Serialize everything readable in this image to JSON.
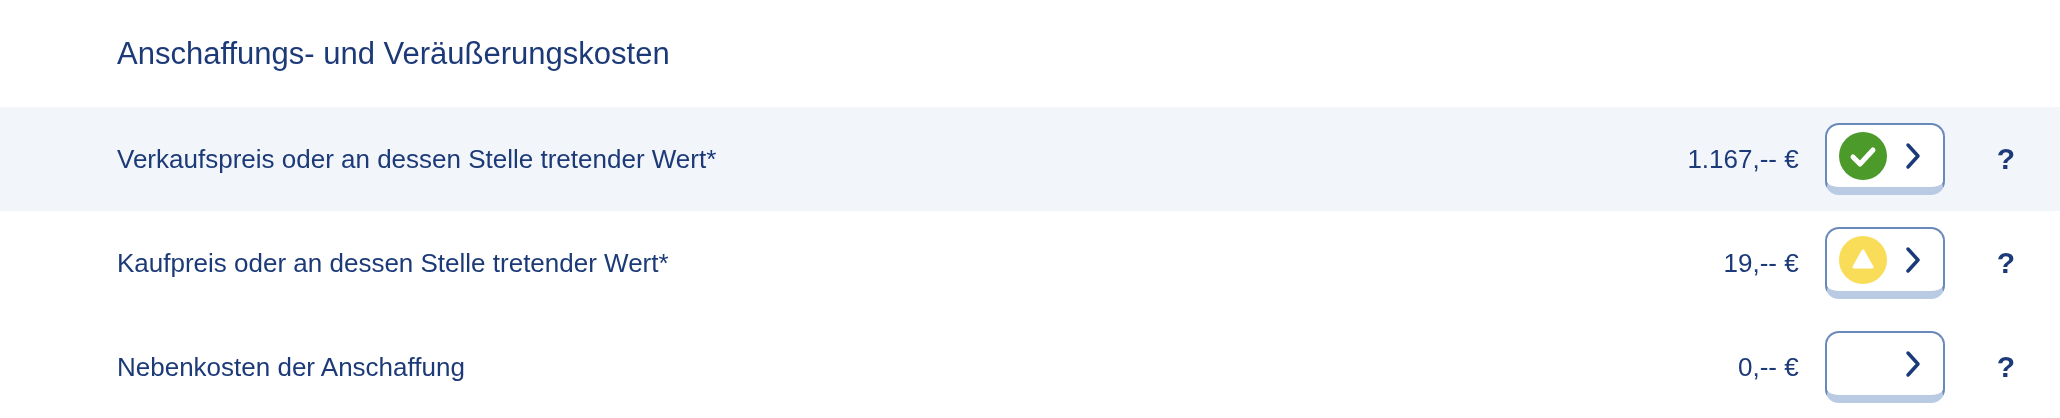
{
  "heading": "Anschaffungs- und Veräußerungskosten",
  "rows": [
    {
      "label": "Verkaufspreis oder an dessen Stelle tretender Wert*",
      "amount": "1.167,-- €",
      "kind": "ok",
      "selected": true,
      "help": "?"
    },
    {
      "label": "Kaufpreis oder an dessen Stelle tretender Wert*",
      "amount": "19,-- €",
      "kind": "warning",
      "selected": false,
      "help": "?"
    },
    {
      "label": "Nebenkosten der Anschaffung",
      "amount": "0,-- €",
      "kind": "empty",
      "selected": false,
      "help": "?"
    }
  ]
}
